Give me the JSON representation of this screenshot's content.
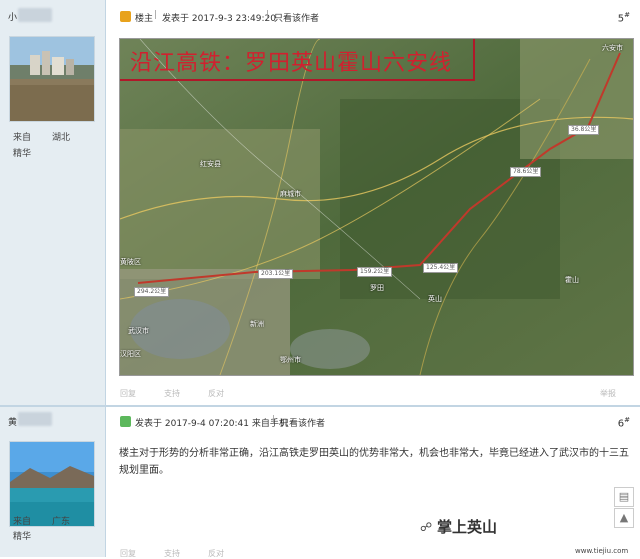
{
  "posts": [
    {
      "username": "小",
      "location_label": "来自",
      "location_value": "湖北",
      "badge": "精华",
      "role": "楼主",
      "posted_label": "发表于 2017-9-3 23:49:20",
      "author_only": "只看该作者",
      "floor": "5",
      "floor_suffix": "#",
      "separator": "|",
      "actions": [
        "回复",
        "支持",
        "反对"
      ],
      "report": "举报"
    },
    {
      "username": "黄",
      "location_label": "来自",
      "location_value": "广东",
      "badge": "精华",
      "posted_label": "发表于 2017-9-4 07:20:41 来自手机",
      "author_only": "只看该作者",
      "floor": "6",
      "floor_suffix": "#",
      "separator": "|",
      "text": "楼主对于形势的分析非常正确，沿江高铁走罗田英山的优势非常大，机会也非常大，毕竟已经进入了武汉市的十三五规划里面。",
      "actions": [
        "回复",
        "支持",
        "反对"
      ]
    }
  ],
  "map": {
    "title": "沿江高铁：罗田英山霍山六安线",
    "distances": [
      "294.2公里",
      "203.1公里",
      "159.2公里",
      "125.4公里",
      "78.6公里",
      "36.8公里"
    ],
    "cities": [
      "六安市",
      "武汉市",
      "罗田",
      "英山",
      "霍山",
      "新洲",
      "麻城市",
      "红安县",
      "黄陂区",
      "汉阳区",
      "鄂州市"
    ]
  },
  "watermark": {
    "brand": "掌上英山",
    "site": "www.tiejiu.com"
  },
  "colors": {
    "sidebar_bg": "#e5edf2",
    "divider": "#c2d5e3",
    "map_title": "#d0212f",
    "route": "#c0392b"
  }
}
